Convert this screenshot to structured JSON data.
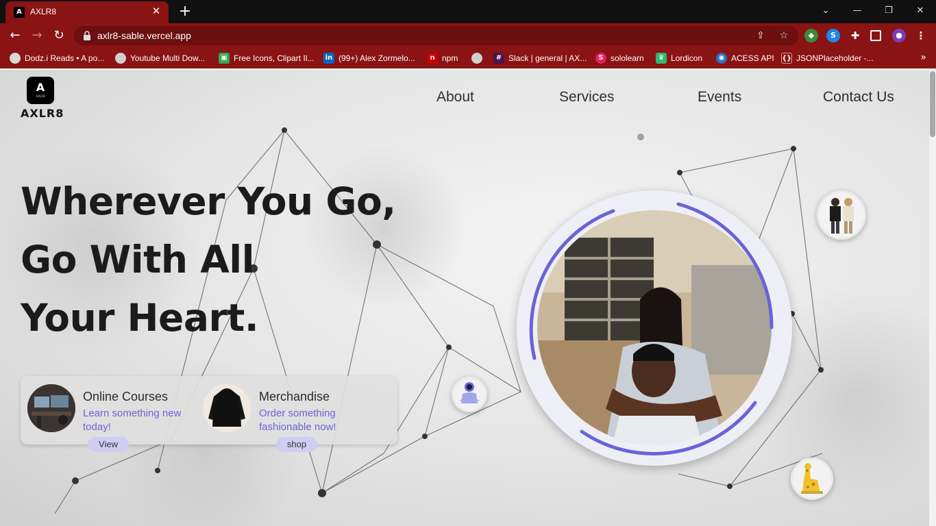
{
  "browser": {
    "tab_title": "AXLR8",
    "favicon_letter": "A",
    "url": "axlr8-sable.vercel.app",
    "bookmarks": [
      {
        "label": "Dodz.i Reads • A po...",
        "icon": "dodzi-icon"
      },
      {
        "label": "Youtube Multi Dow...",
        "icon": "globe-icon"
      },
      {
        "label": "Free Icons, Clipart Il...",
        "icon": "freeicons-icon"
      },
      {
        "label": "(99+) Alex Zormelo...",
        "icon": "linkedin-icon"
      },
      {
        "label": "npm",
        "icon": "npm-icon"
      },
      {
        "label": "",
        "icon": "globe-icon"
      },
      {
        "label": "Slack | general | AX...",
        "icon": "slack-icon"
      },
      {
        "label": "sololearn",
        "icon": "sololearn-icon"
      },
      {
        "label": "Lordicon",
        "icon": "lordicon-icon"
      },
      {
        "label": "ACESS API",
        "icon": "api-icon"
      },
      {
        "label": "JSONPlaceholder -...",
        "icon": "jsonplaceholder-icon"
      }
    ],
    "colors": {
      "chrome": "#8a1313",
      "tabstrip": "#111111"
    }
  },
  "site": {
    "logo_glyph": "A",
    "logo_subtext": "AXLR8",
    "brand": "AXLR8",
    "nav": [
      "About",
      "Services",
      "Events",
      "Contact Us"
    ],
    "headline": [
      "Wherever You Go,",
      "Go With All",
      "Your Heart."
    ],
    "cards": [
      {
        "title": "Online Courses",
        "subtitle": "Learn something new today!",
        "button": "View",
        "thumb_icon": "computer-setup-icon"
      },
      {
        "title": "Merchandise",
        "subtitle": "Order something fashionable now!",
        "button": "shop",
        "thumb_icon": "hoodie-icon"
      }
    ],
    "colors": {
      "accent": "#6a63d6",
      "pill": "#cfcdf1",
      "text": "#1b1b1b"
    }
  }
}
